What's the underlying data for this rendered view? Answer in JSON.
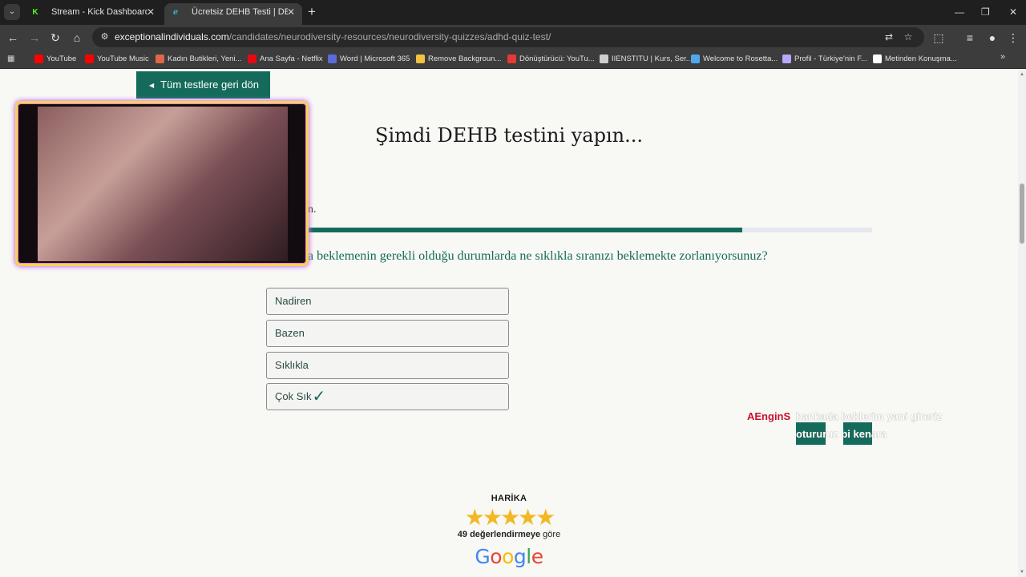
{
  "browser": {
    "tabs": [
      {
        "title": "Stream - Kick Dashboard",
        "favicon": "K",
        "active": false
      },
      {
        "title": "Ücretsiz DEHB Testi | DEHB'im V",
        "favicon": "ℯ",
        "active": true
      }
    ],
    "url_host": "exceptionalindividuals.com",
    "url_path": "/candidates/neurodiversity-resources/neurodiversity-quizzes/adhd-quiz-test/",
    "bookmarks": [
      {
        "label": "YouTube",
        "color": "#ff0000"
      },
      {
        "label": "YouTube Music",
        "color": "#ff0000"
      },
      {
        "label": "Kadın Butikleri, Yeni...",
        "color": "#e0664a"
      },
      {
        "label": "Ana Sayfa - Netflix",
        "color": "#e50914"
      },
      {
        "label": "Word | Microsoft 365",
        "color": "#5a6cd8"
      },
      {
        "label": "Remove Backgroun...",
        "color": "#f4c242"
      },
      {
        "label": "Dönüştürücü: YouTu...",
        "color": "#e53935"
      },
      {
        "label": "IIENSTITU | Kurs, Ser...",
        "color": "#cfcfcf"
      },
      {
        "label": "Welcome to Rosetta...",
        "color": "#4ea8f0"
      },
      {
        "label": "Profil - Türkiye'nin F...",
        "color": "#b9a7ff"
      },
      {
        "label": "Metinden Konuşma...",
        "color": "#ffffff"
      }
    ]
  },
  "page": {
    "back_button": "Tüm testlere geri dön",
    "title": "Şimdi DEHB testini yapın...",
    "step_fragment": "n.",
    "progress": 0.77,
    "question": "a beklemenin gerekli olduğu durumlarda ne sıklıkla sıranızı beklemekte zorlanıyorsunuz?",
    "options": [
      "Nadiren",
      "Bazen",
      "Sıklıkla",
      "Çok Sık"
    ],
    "selected_option": 3,
    "check_mark": "✓",
    "rating_word": "HARİKA",
    "stars": "★★★★★",
    "review_count_bold": "49 değerlendirmeye",
    "review_count_rest": " göre",
    "google": [
      "G",
      "o",
      "o",
      "g",
      "l",
      "e"
    ]
  },
  "chat": {
    "username": "AEnginS",
    "line1": "bankada beklerim yani gireriz",
    "line2": "otururuz bi kenara",
    "colors": {
      "username": "#c8102e",
      "highlight": "#156b5b"
    }
  },
  "colors": {
    "accent": "#156b5b",
    "star": "#f2b823",
    "google": [
      "#4285f4",
      "#ea4335",
      "#fbbc05",
      "#4285f4",
      "#34a853",
      "#ea4335"
    ]
  }
}
